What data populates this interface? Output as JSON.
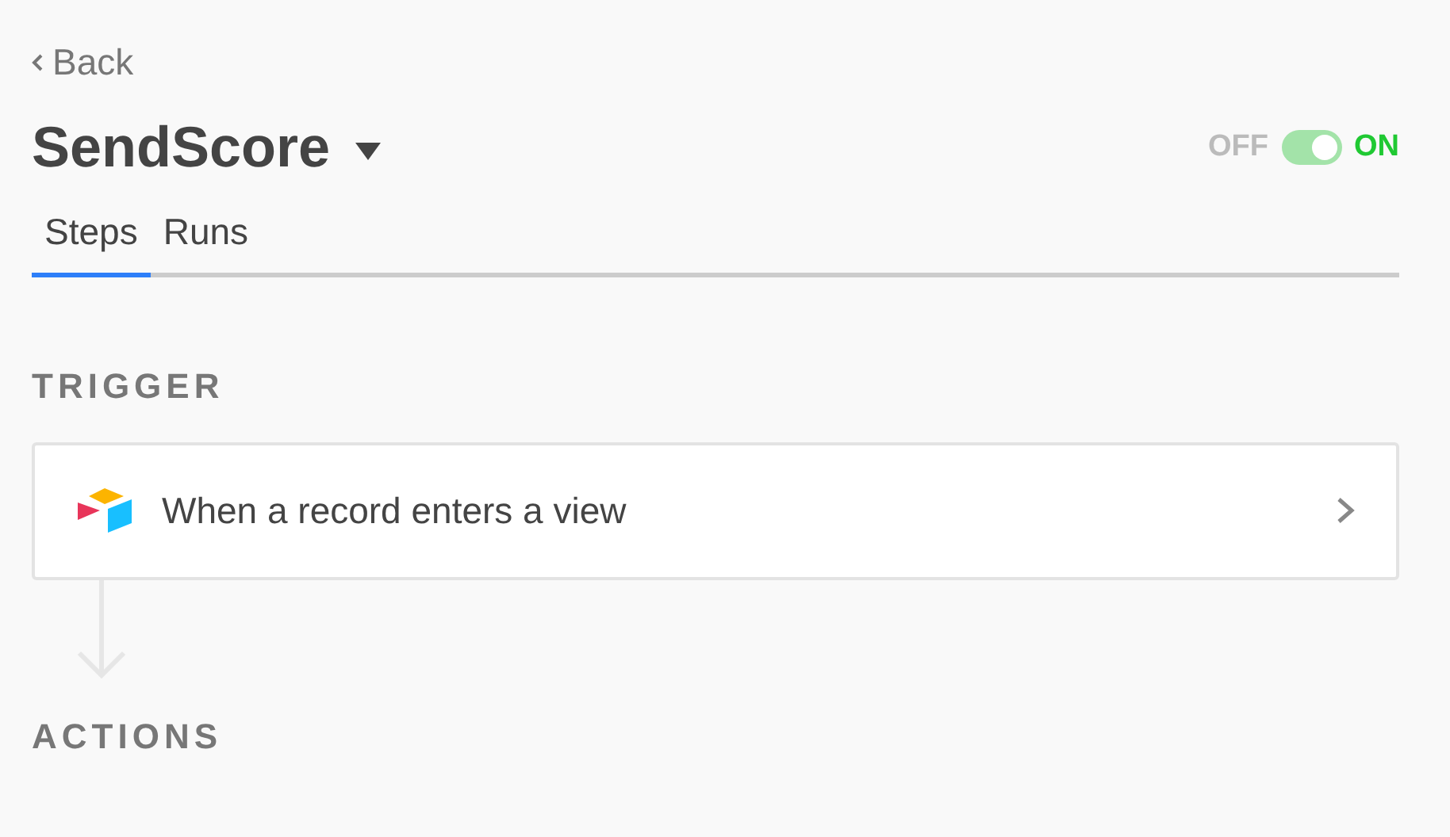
{
  "back": {
    "label": "Back"
  },
  "title": "SendScore",
  "toggle": {
    "off_label": "OFF",
    "on_label": "ON",
    "on": true
  },
  "tabs": [
    {
      "label": "Steps",
      "selected": true
    },
    {
      "label": "Runs",
      "selected": false
    }
  ],
  "trigger": {
    "heading": "TRIGGER",
    "step": "When a record enters a view"
  },
  "actions": {
    "heading": "ACTIONS"
  }
}
